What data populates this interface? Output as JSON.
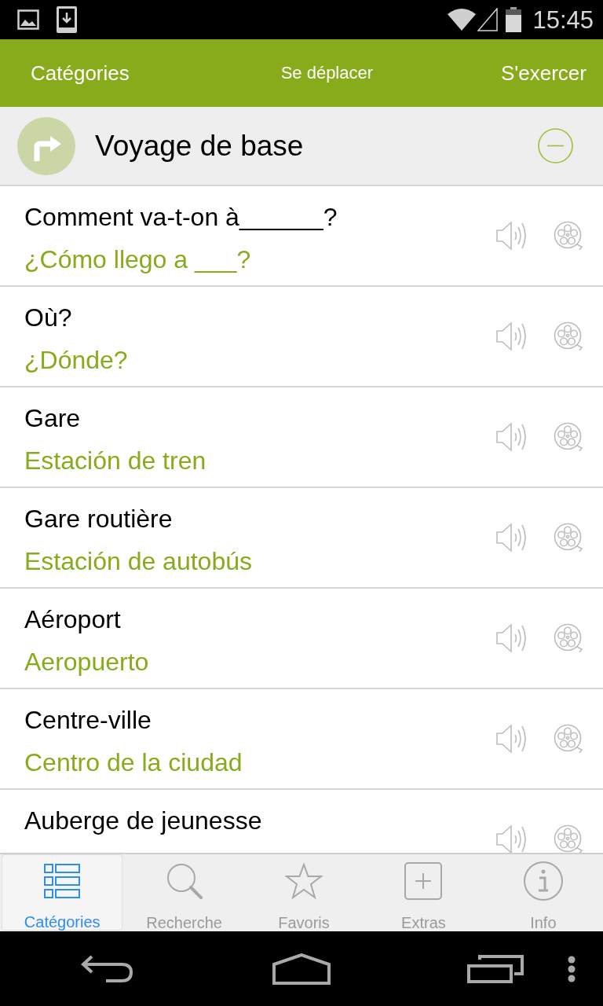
{
  "status_bar": {
    "time": "15:45"
  },
  "header": {
    "left": "Catégories",
    "title": "Se déplacer",
    "right": "S'exercer"
  },
  "category": {
    "title": "Voyage de base",
    "expanded": true
  },
  "phrases": [
    {
      "phrase": "Comment va-t-on à______?",
      "translation": "¿Cómo llego a ___?"
    },
    {
      "phrase": "Où?",
      "translation": "¿Dónde?"
    },
    {
      "phrase": "Gare",
      "translation": "Estación de tren"
    },
    {
      "phrase": "Gare routière",
      "translation": "Estación de autobús"
    },
    {
      "phrase": "Aéroport",
      "translation": "Aeropuerto"
    },
    {
      "phrase": "Centre-ville",
      "translation": "Centro de la ciudad"
    },
    {
      "phrase": "Auberge de jeunesse"
    }
  ],
  "tab_bar": [
    {
      "label": "Catégories",
      "selected": true
    },
    {
      "label": "Recherche",
      "selected": false
    },
    {
      "label": "Favoris",
      "selected": false
    },
    {
      "label": "Extras",
      "selected": false
    },
    {
      "label": "Info",
      "selected": false
    }
  ]
}
